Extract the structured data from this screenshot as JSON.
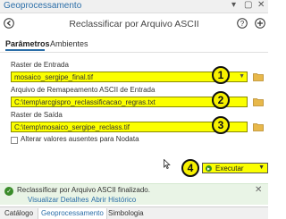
{
  "window": {
    "title": "Geoprocessamento",
    "controls": [
      "▾",
      "▢",
      "✕"
    ]
  },
  "tool": {
    "title": "Reclassificar por Arquivo ASCII"
  },
  "tabs": [
    {
      "label": "Parâmetros",
      "active": true
    },
    {
      "label": "Ambientes",
      "active": false
    }
  ],
  "params": {
    "input_raster": {
      "label": "Raster de Entrada",
      "value": "mosaico_sergipe_final.tif",
      "badge": "1"
    },
    "remap_file": {
      "label": "Arquivo de Remapeamento ASCII de Entrada",
      "value": "C:\\temp\\arcgispro_reclassificacao_regras.txt",
      "badge": "2"
    },
    "output_raster": {
      "label": "Raster de Saída",
      "value": "C:\\temp\\mosaico_sergipe_reclass.tif",
      "badge": "3"
    },
    "missing_nodata": {
      "label": "Alterar valores ausentes para Nodata",
      "checked": false
    }
  },
  "run": {
    "label": "Executar",
    "badge": "4"
  },
  "message": {
    "text": "Reclassificar por Arquivo ASCII finalizado.",
    "view_details": "Visualizar Detalhes",
    "open_history": "Abrir Histórico"
  },
  "bottom_tabs": [
    {
      "label": "Catálogo",
      "active": false
    },
    {
      "label": "Geoprocessamento",
      "active": true
    },
    {
      "label": "Simbologia",
      "active": false
    }
  ],
  "colors": {
    "highlight": "#fbff00",
    "accent": "#2b6ea8",
    "success": "#3a8c2a"
  }
}
